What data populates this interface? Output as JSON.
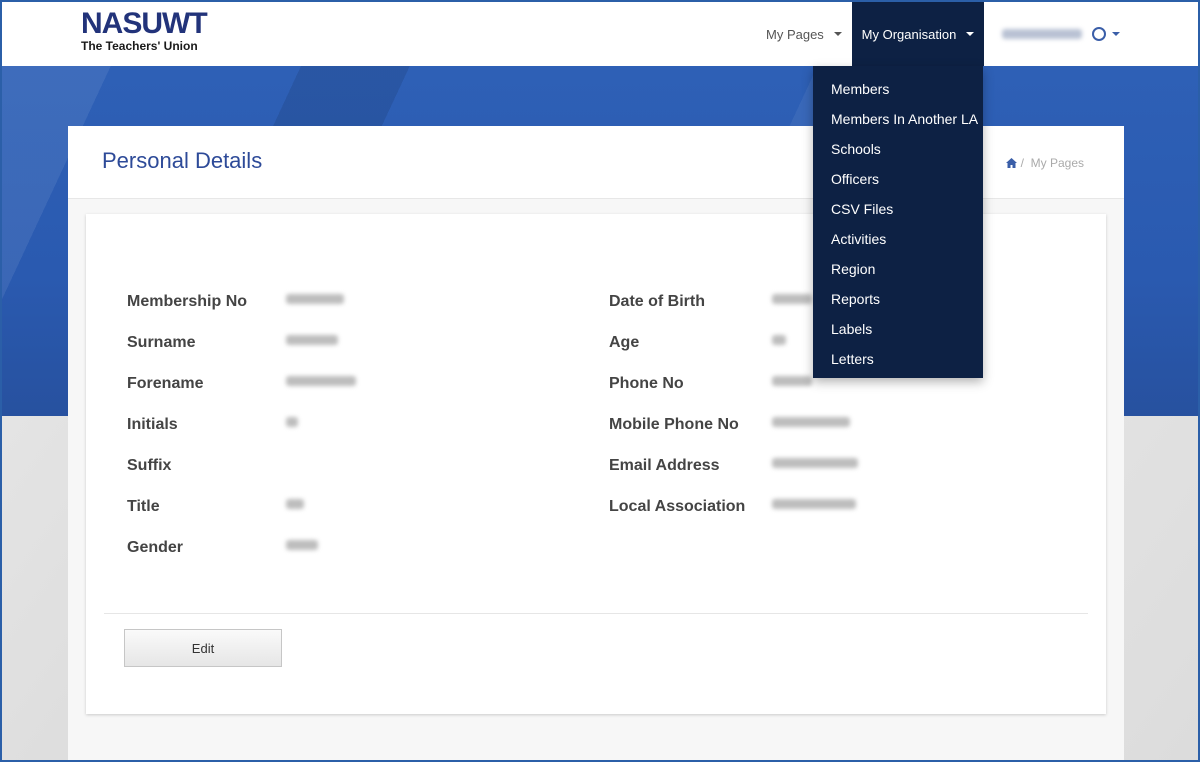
{
  "logo": {
    "name": "NASUWT",
    "tagline": "The Teachers' Union"
  },
  "nav": {
    "my_pages": "My Pages",
    "my_organisation": "My Organisation",
    "user_email": "[redacted email]"
  },
  "dropdown": [
    "Members",
    "Members In Another LA",
    "Schools",
    "Officers",
    "CSV Files",
    "Activities",
    "Region",
    "Reports",
    "Labels",
    "Letters"
  ],
  "page": {
    "title": "Personal Details",
    "breadcrumb": "My Pages"
  },
  "left_fields": [
    {
      "label": "Membership No"
    },
    {
      "label": "Surname"
    },
    {
      "label": "Forename"
    },
    {
      "label": "Initials"
    },
    {
      "label": "Suffix"
    },
    {
      "label": "Title"
    },
    {
      "label": "Gender"
    }
  ],
  "right_fields": [
    {
      "label": "Date of Birth"
    },
    {
      "label": "Age"
    },
    {
      "label": "Phone No"
    },
    {
      "label": "Mobile Phone No"
    },
    {
      "label": "Email Address"
    },
    {
      "label": "Local Association"
    }
  ],
  "buttons": {
    "edit": "Edit"
  },
  "colors": {
    "brand": "#22337a",
    "nav_active": "#0d2144",
    "hero": "#2e60b6",
    "title": "#2d4a98"
  }
}
